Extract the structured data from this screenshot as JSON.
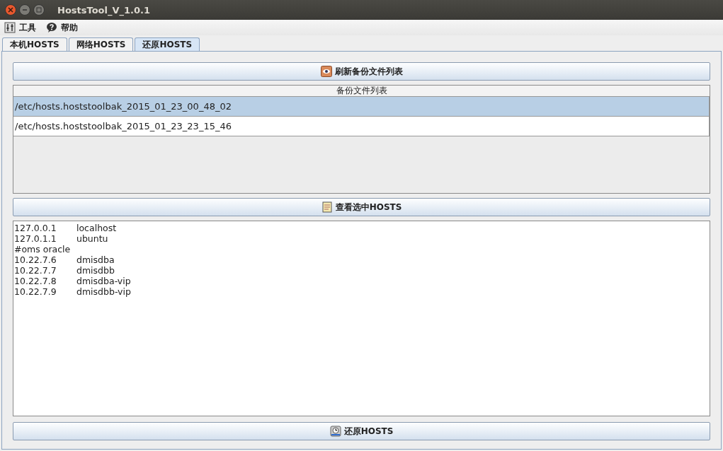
{
  "window": {
    "title": "HostsTool_V_1.0.1"
  },
  "menu": [
    "工具",
    "帮助"
  ],
  "tabs": [
    {
      "label": "本机HOSTS",
      "selected": false
    },
    {
      "label": "网络HOSTS",
      "selected": false
    },
    {
      "label": "还原HOSTS",
      "selected": true
    }
  ],
  "refresh_button": "刷新备份文件列表",
  "backup_table": {
    "column": "备份文件列表",
    "rows": [
      {
        "path": "/etc/hosts.hoststoolbak_2015_01_23_00_48_02",
        "selected": true
      },
      {
        "path": "/etc/hosts.hoststoolbak_2015_01_23_23_15_46",
        "selected": false
      }
    ]
  },
  "view_button": "查看选中HOSTS",
  "hosts_lines": [
    {
      "kind": "entry",
      "ip": "127.0.0.1",
      "host": "localhost"
    },
    {
      "kind": "entry",
      "ip": "127.0.1.1",
      "host": "ubuntu"
    },
    {
      "kind": "comment",
      "text": "#oms oracle"
    },
    {
      "kind": "entry",
      "ip": "10.22.7.6",
      "host": "dmisdba"
    },
    {
      "kind": "entry",
      "ip": "10.22.7.7",
      "host": "dmisdbb"
    },
    {
      "kind": "entry",
      "ip": "10.22.7.8",
      "host": "dmisdba-vip"
    },
    {
      "kind": "entry",
      "ip": "10.22.7.9",
      "host": "dmisdbb-vip"
    }
  ],
  "restore_button": "还原HOSTS"
}
